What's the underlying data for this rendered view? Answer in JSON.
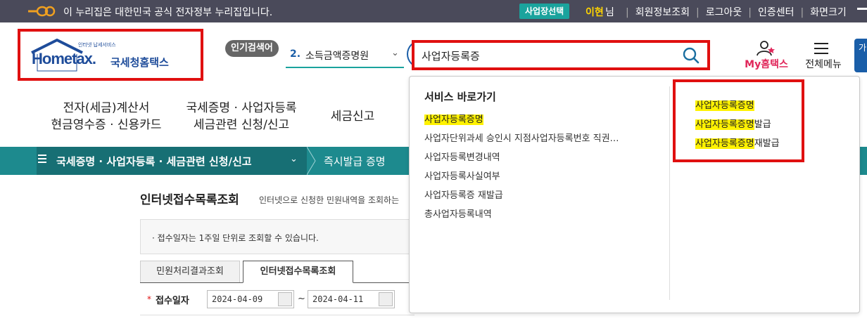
{
  "gov_bar": {
    "text": "이 누리집은 대한민국 공식 전자정부 누리집입니다.",
    "business_select": "사업장선택",
    "user_name": "이현",
    "user_suffix": "님",
    "links": [
      "회원정보조회",
      "로그아웃",
      "인증센터",
      "화면크기"
    ]
  },
  "header": {
    "logo_small": "인터넷 납세서비스",
    "logo_home": "Hometax.",
    "logo_korean": "국세청홈택스",
    "popular_label": "인기검색어",
    "popular_rank": "2.",
    "popular_item": "소득금액증명원",
    "search_value": "사업자등록증",
    "my_hometax": "My홈택스",
    "all_menu": "전체메뉴",
    "right_fragment": "가"
  },
  "gnb": [
    {
      "line1": "전자(세금)계산서",
      "line2": "현금영수증 · 신용카드"
    },
    {
      "line1": "국세증명 · 사업자등록",
      "line2": "세금관련 신청/신고"
    },
    {
      "line1": "세금신고",
      "line2": ""
    }
  ],
  "breadcrumb": {
    "level1": "국세증명 · 사업자등록 · 세금관련 신청/신고",
    "level2": "즉시발급 증명"
  },
  "page": {
    "title": "인터넷접수목록조회",
    "desc": "인터넷으로 신청한 민원내역을 조회하는",
    "notice": "· 접수일자는 1주일 단위로 조회할 수 있습니다.",
    "tabs": [
      "민원처리결과조회",
      "인터넷접수목록조회"
    ],
    "filter_label": "접수일자",
    "date_from": "2024-04-09",
    "date_to": "2024-04-11",
    "tilde": "~"
  },
  "dropdown": {
    "title": "서비스 바로가기",
    "left_items": [
      {
        "hl": "사업자등록증명",
        "rest": ""
      },
      {
        "hl": "",
        "rest": "사업자단위과세 승인시 지점사업자등록번호 직권…"
      },
      {
        "hl": "",
        "rest": "사업자등록변경내역"
      },
      {
        "hl": "",
        "rest": "사업자등록사실여부"
      },
      {
        "hl": "",
        "rest": "사업자등록증 재발급"
      },
      {
        "hl": "",
        "rest": "총사업자등록내역"
      }
    ],
    "right_items": [
      {
        "hl": "사업자등록증명",
        "rest": ""
      },
      {
        "hl": "사업자등록증명",
        "rest": "발급"
      },
      {
        "hl": "사업자등록증명",
        "rest": "재발급"
      }
    ]
  },
  "colors": {
    "teal": "#1d8a8e",
    "highlight": "#fff200",
    "annotation_red": "#e01010",
    "brand_blue": "#1e4c9a",
    "my_pink": "#e0265a"
  }
}
